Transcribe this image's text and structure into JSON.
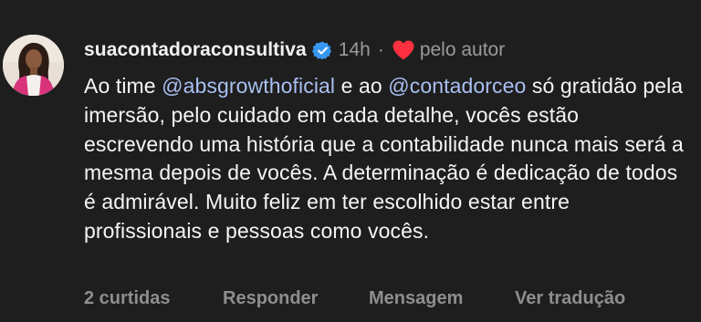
{
  "comment": {
    "username": "suacontadoraconsultiva",
    "time": "14h",
    "separator": "·",
    "liked_by_author_label": "pelo autor",
    "body": {
      "p1": "Ao time ",
      "mention1": "@absgrowthoficial",
      "p2": " e ao ",
      "mention2": "@contadorceo",
      "p3": " só gratidão pela imersão, pelo cuidado em cada detalhe, vocês estão escrevendo uma história que a contabilidade nunca mais será a mesma depois de vocês. A determinação é dedicação de todos é admirável. Muito feliz em ter escolhido estar entre profissionais e pessoas como vocês."
    },
    "actions": {
      "likes": "2 curtidas",
      "reply": "Responder",
      "message": "Mensagem",
      "translate": "Ver tradução"
    }
  },
  "icons": {
    "verified": "verified-badge-icon",
    "heart": "heart-icon",
    "avatar": "avatar"
  },
  "colors": {
    "background": "#1e1e1e",
    "mention": "#a9bff2",
    "verified": "#3897f0",
    "heart": "#ff3040",
    "muted": "#9a9a9a"
  }
}
